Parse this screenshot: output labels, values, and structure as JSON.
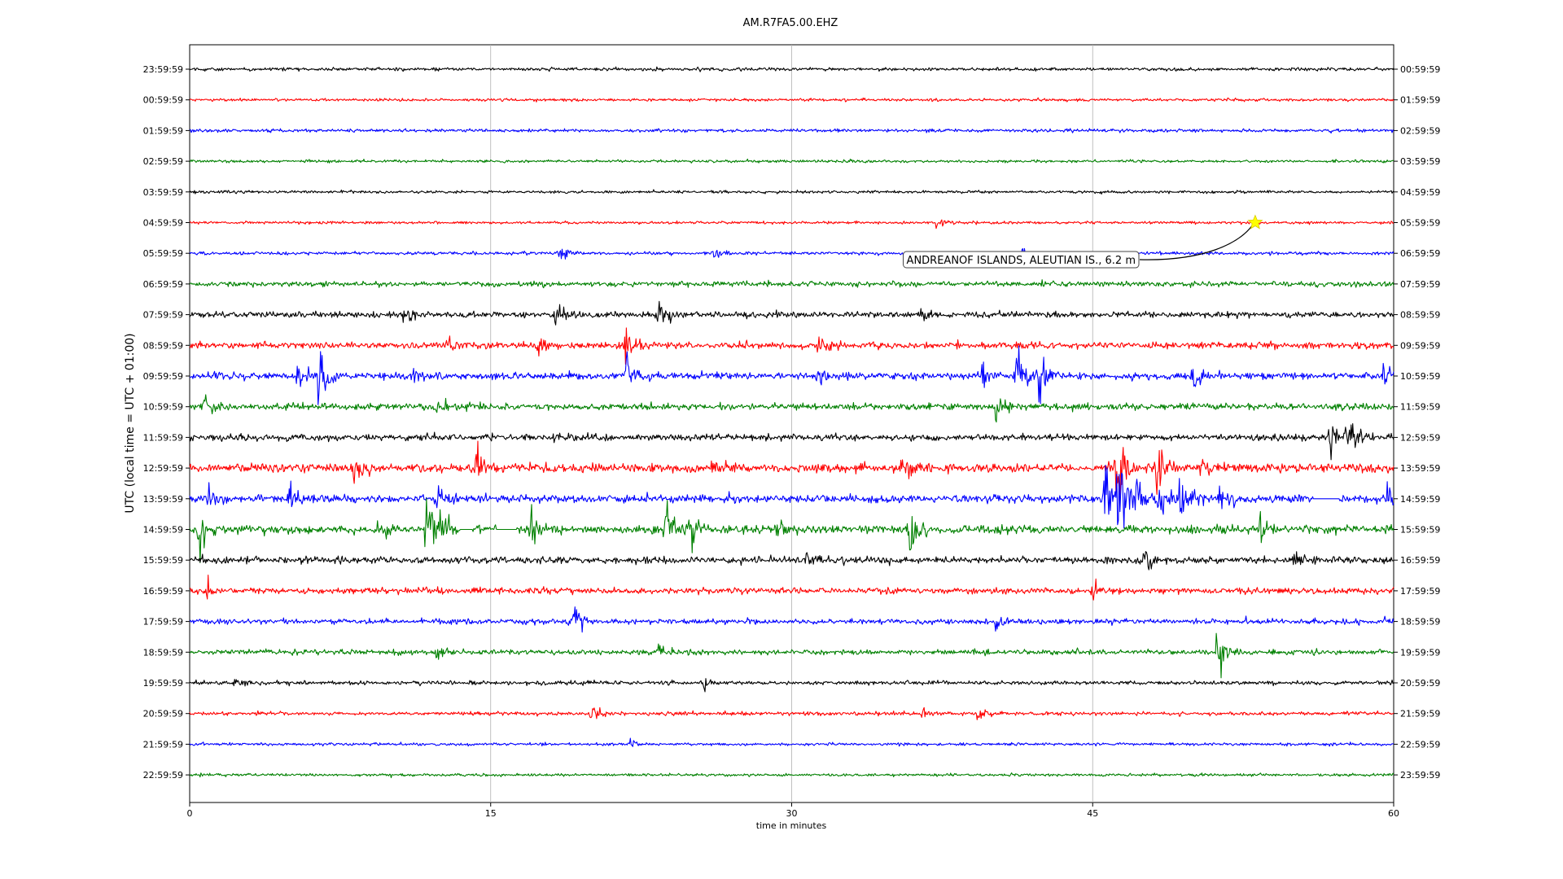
{
  "chart_data": {
    "type": "line",
    "title": "AM.R7FA5.00.EHZ",
    "xlabel": "time in minutes",
    "ylabel": "UTC (local time = UTC + 01:00)",
    "xlim": [
      0,
      60
    ],
    "xticks": [
      0,
      15,
      30,
      45,
      60
    ],
    "grid_x": true,
    "colors_cycle": [
      "#000000",
      "#ff0000",
      "#0000ff",
      "#008000"
    ],
    "left_labels": [
      "23:59:59",
      "00:59:59",
      "01:59:59",
      "02:59:59",
      "03:59:59",
      "04:59:59",
      "05:59:59",
      "06:59:59",
      "07:59:59",
      "08:59:59",
      "09:59:59",
      "10:59:59",
      "11:59:59",
      "12:59:59",
      "13:59:59",
      "14:59:59",
      "15:59:59",
      "16:59:59",
      "17:59:59",
      "18:59:59",
      "19:59:59",
      "20:59:59",
      "21:59:59",
      "22:59:59"
    ],
    "right_labels": [
      "00:59:59",
      "01:59:59",
      "02:59:59",
      "03:59:59",
      "04:59:59",
      "05:59:59",
      "06:59:59",
      "07:59:59",
      "08:59:59",
      "09:59:59",
      "10:59:59",
      "11:59:59",
      "12:59:59",
      "13:59:59",
      "14:59:59",
      "15:59:59",
      "16:59:59",
      "17:59:59",
      "18:59:59",
      "19:59:59",
      "20:59:59",
      "21:59:59",
      "22:59:59",
      "23:59:59"
    ],
    "noise_levels": [
      0.35,
      0.3,
      0.35,
      0.3,
      0.3,
      0.3,
      0.35,
      0.55,
      0.65,
      0.7,
      0.75,
      0.75,
      0.7,
      0.95,
      0.85,
      0.9,
      0.75,
      0.65,
      0.6,
      0.55,
      0.45,
      0.4,
      0.3,
      0.3
    ],
    "events": [
      {
        "trace": 5,
        "minute": 37.2,
        "amp": 1.4
      },
      {
        "trace": 6,
        "minute": 18.4,
        "amp": 2.0
      },
      {
        "trace": 6,
        "minute": 26.2,
        "amp": 1.6
      },
      {
        "trace": 6,
        "minute": 41.5,
        "amp": 1.8
      },
      {
        "trace": 8,
        "minute": 10.7,
        "amp": 2.4
      },
      {
        "trace": 8,
        "minute": 18.3,
        "amp": 3.2
      },
      {
        "trace": 8,
        "minute": 23.3,
        "amp": 4.0
      },
      {
        "trace": 8,
        "minute": 36.5,
        "amp": 2.2
      },
      {
        "trace": 9,
        "minute": 12.8,
        "amp": 2.0
      },
      {
        "trace": 9,
        "minute": 17.4,
        "amp": 2.6
      },
      {
        "trace": 9,
        "minute": 21.7,
        "amp": 5.0
      },
      {
        "trace": 9,
        "minute": 31.3,
        "amp": 2.4
      },
      {
        "trace": 10,
        "minute": 5.4,
        "amp": 3.0
      },
      {
        "trace": 10,
        "minute": 6.4,
        "amp": 7.0
      },
      {
        "trace": 10,
        "minute": 11.1,
        "amp": 2.0
      },
      {
        "trace": 10,
        "minute": 21.8,
        "amp": 5.5
      },
      {
        "trace": 10,
        "minute": 31.3,
        "amp": 3.0
      },
      {
        "trace": 10,
        "minute": 39.5,
        "amp": 2.5
      },
      {
        "trace": 10,
        "minute": 41.2,
        "amp": 6.5
      },
      {
        "trace": 10,
        "minute": 42.3,
        "amp": 6.0
      },
      {
        "trace": 10,
        "minute": 50.0,
        "amp": 3.0
      },
      {
        "trace": 10,
        "minute": 59.5,
        "amp": 3.5
      },
      {
        "trace": 11,
        "minute": 0.8,
        "amp": 2.5
      },
      {
        "trace": 11,
        "minute": 12.3,
        "amp": 2.0
      },
      {
        "trace": 11,
        "minute": 40.2,
        "amp": 2.0
      },
      {
        "trace": 12,
        "minute": 56.8,
        "amp": 4.0
      },
      {
        "trace": 12,
        "minute": 57.7,
        "amp": 4.5
      },
      {
        "trace": 13,
        "minute": 8.2,
        "amp": 4.5
      },
      {
        "trace": 13,
        "minute": 14.3,
        "amp": 4.0
      },
      {
        "trace": 13,
        "minute": 26.0,
        "amp": 3.0
      },
      {
        "trace": 13,
        "minute": 35.5,
        "amp": 4.5
      },
      {
        "trace": 13,
        "minute": 46.2,
        "amp": 15.0
      },
      {
        "trace": 13,
        "minute": 48.2,
        "amp": 6.0
      },
      {
        "trace": 13,
        "minute": 50.3,
        "amp": 4.0
      },
      {
        "trace": 14,
        "minute": 1.0,
        "amp": 3.0
      },
      {
        "trace": 14,
        "minute": 5.0,
        "amp": 3.0
      },
      {
        "trace": 14,
        "minute": 12.3,
        "amp": 3.0
      },
      {
        "trace": 14,
        "minute": 45.6,
        "amp": 9.0
      },
      {
        "trace": 14,
        "minute": 46.3,
        "amp": 15.0
      },
      {
        "trace": 14,
        "minute": 47.2,
        "amp": 5.0
      },
      {
        "trace": 14,
        "minute": 48.3,
        "amp": 6.0
      },
      {
        "trace": 14,
        "minute": 49.4,
        "amp": 8.5
      },
      {
        "trace": 14,
        "minute": 51.3,
        "amp": 4.0
      },
      {
        "trace": 14,
        "minute": 59.7,
        "amp": 3.0
      },
      {
        "trace": 15,
        "minute": 0.5,
        "amp": 5.0
      },
      {
        "trace": 15,
        "minute": 9.4,
        "amp": 3.0
      },
      {
        "trace": 15,
        "minute": 11.8,
        "amp": 7.5
      },
      {
        "trace": 15,
        "minute": 12.5,
        "amp": 4.0
      },
      {
        "trace": 15,
        "minute": 17.0,
        "amp": 7.0
      },
      {
        "trace": 15,
        "minute": 23.7,
        "amp": 5.0
      },
      {
        "trace": 15,
        "minute": 25.0,
        "amp": 4.0
      },
      {
        "trace": 15,
        "minute": 29.2,
        "amp": 3.5
      },
      {
        "trace": 15,
        "minute": 35.9,
        "amp": 6.0
      },
      {
        "trace": 15,
        "minute": 53.4,
        "amp": 3.5
      },
      {
        "trace": 16,
        "minute": 30.8,
        "amp": 2.0
      },
      {
        "trace": 16,
        "minute": 47.5,
        "amp": 2.5
      },
      {
        "trace": 16,
        "minute": 55.0,
        "amp": 2.5
      },
      {
        "trace": 17,
        "minute": 0.9,
        "amp": 2.0
      },
      {
        "trace": 17,
        "minute": 45.0,
        "amp": 2.0
      },
      {
        "trace": 18,
        "minute": 19.2,
        "amp": 3.0
      },
      {
        "trace": 18,
        "minute": 40.2,
        "amp": 1.6
      },
      {
        "trace": 19,
        "minute": 12.2,
        "amp": 1.8
      },
      {
        "trace": 19,
        "minute": 23.3,
        "amp": 3.0
      },
      {
        "trace": 19,
        "minute": 51.2,
        "amp": 5.0
      },
      {
        "trace": 20,
        "minute": 2.3,
        "amp": 1.5
      },
      {
        "trace": 20,
        "minute": 25.6,
        "amp": 1.4
      },
      {
        "trace": 21,
        "minute": 20.0,
        "amp": 2.5
      },
      {
        "trace": 21,
        "minute": 36.5,
        "amp": 1.3
      },
      {
        "trace": 21,
        "minute": 39.3,
        "amp": 1.4
      },
      {
        "trace": 22,
        "minute": 22.0,
        "amp": 1.3
      }
    ],
    "gaps": [
      {
        "trace": 14,
        "from": 56.0,
        "to": 57.3
      },
      {
        "trace": 15,
        "from": 13.5,
        "to": 14.1
      },
      {
        "trace": 15,
        "from": 15.3,
        "to": 16.3
      }
    ],
    "event_marker": {
      "trace": 5,
      "minute": 53.1,
      "color": "#ffff00",
      "label": "ANDREANOF ISLANDS, ALEUTIAN IS., 6.2 m"
    }
  }
}
